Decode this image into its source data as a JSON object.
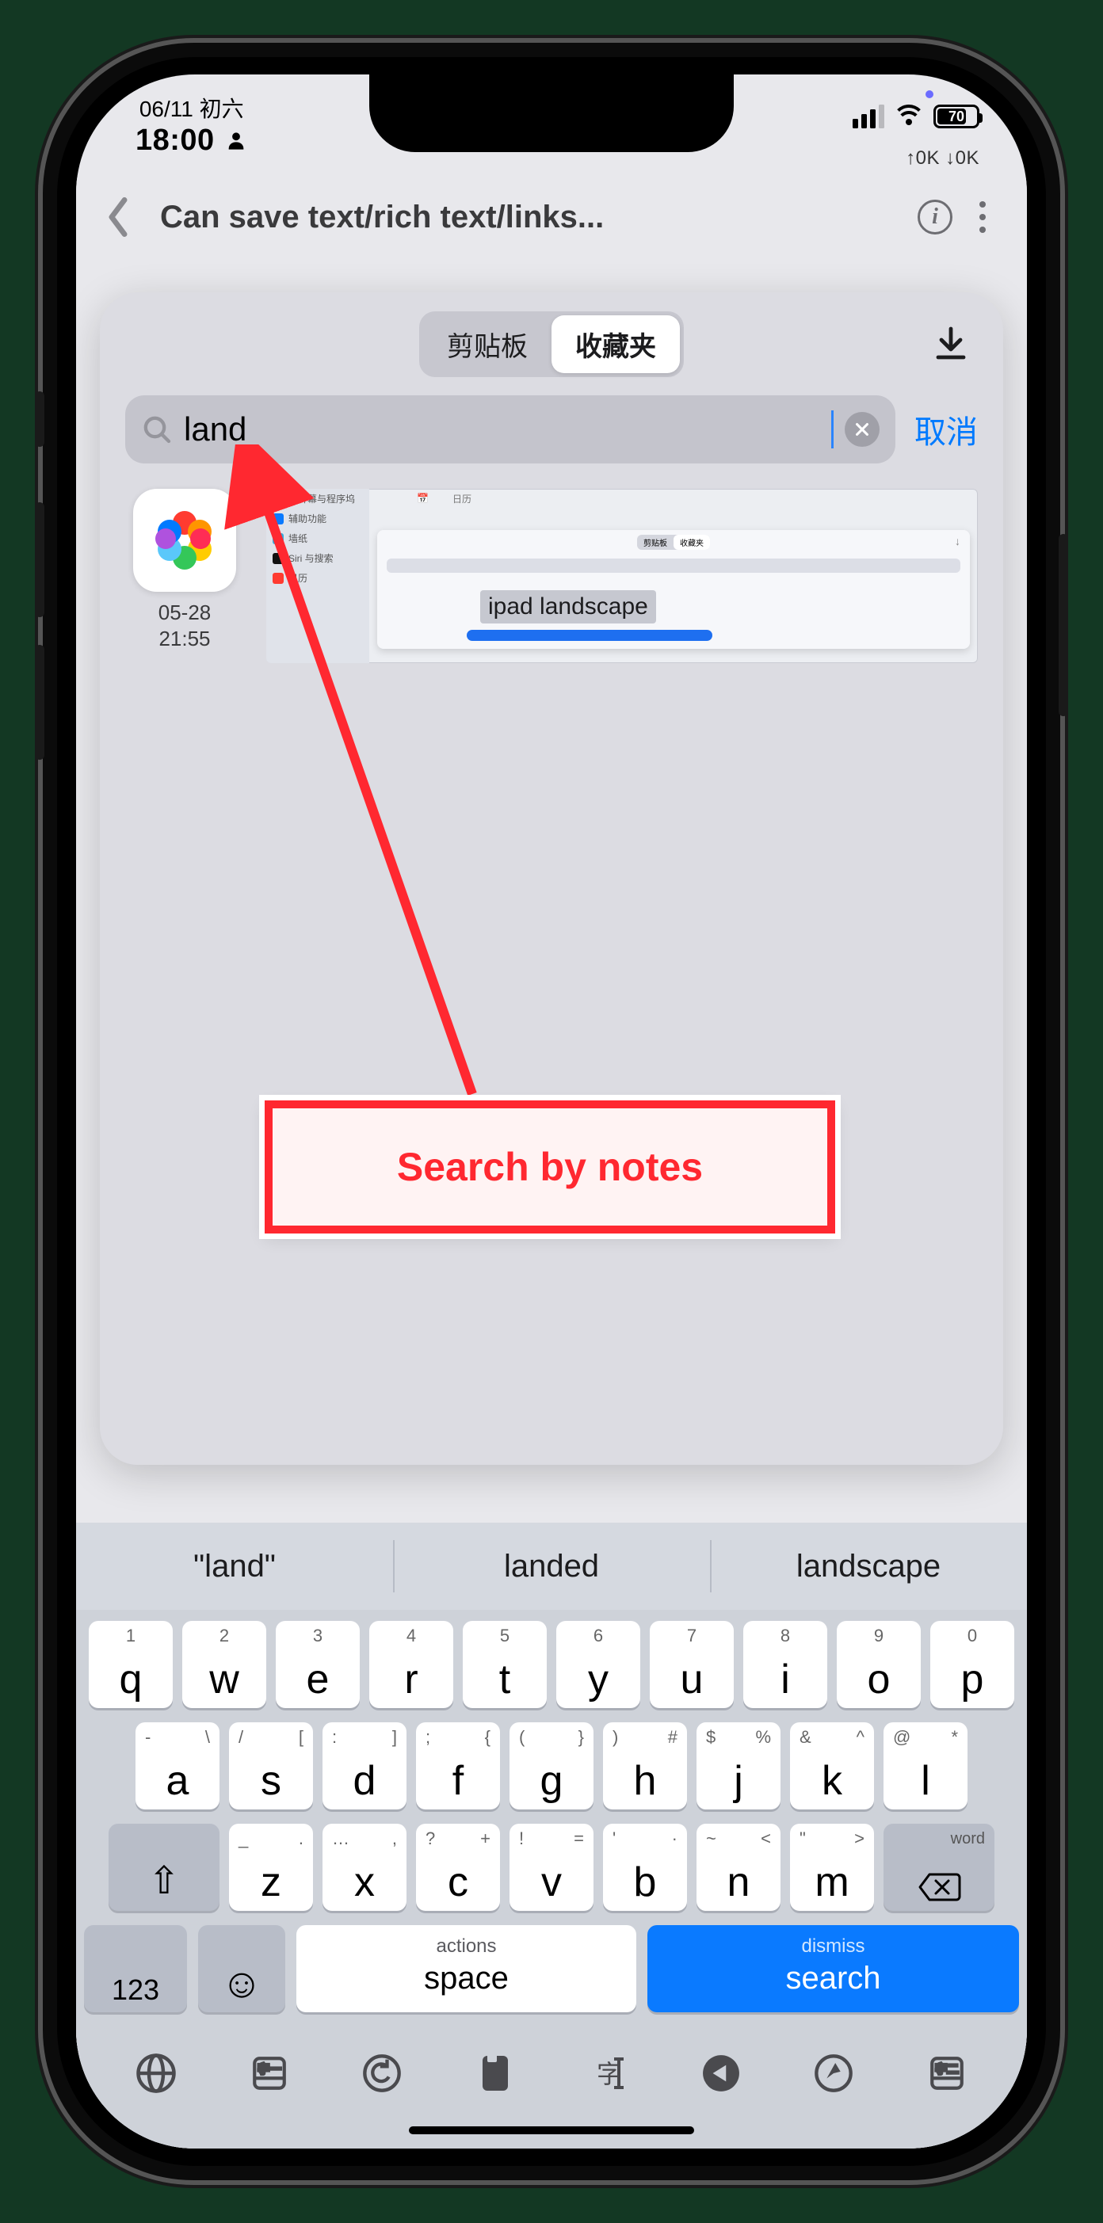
{
  "status": {
    "date_line": "06/11 初六",
    "time": "18:00",
    "battery_pct": "70",
    "net_stats": "↑0K ↓0K"
  },
  "nav": {
    "title": "Can save text/rich text/links..."
  },
  "sheet": {
    "tabs": {
      "clipboard": "剪贴板",
      "favorites": "收藏夹"
    },
    "search_value": "land",
    "cancel": "取消",
    "result": {
      "timestamp_line1": "05-28",
      "timestamp_line2": "21:55",
      "highlight_text": "ipad landscape",
      "preview_sidebar": [
        "主屏幕与程序坞",
        "辅助功能",
        "墙纸",
        "Siri 与搜索",
        "日历"
      ],
      "preview_hdr_cal": "日历"
    },
    "annotation": "Search by notes"
  },
  "keyboard": {
    "suggestions": [
      "\"land\"",
      "landed",
      "landscape"
    ],
    "row1": [
      {
        "m": "q",
        "l": "1"
      },
      {
        "m": "w",
        "l": "2"
      },
      {
        "m": "e",
        "l": "3"
      },
      {
        "m": "r",
        "l": "4"
      },
      {
        "m": "t",
        "l": "5"
      },
      {
        "m": "y",
        "l": "6"
      },
      {
        "m": "u",
        "l": "7"
      },
      {
        "m": "i",
        "l": "8"
      },
      {
        "m": "o",
        "l": "9"
      },
      {
        "m": "p",
        "l": "0"
      }
    ],
    "row2": [
      {
        "m": "a",
        "l": "-",
        "r": "\\"
      },
      {
        "m": "s",
        "l": "/",
        "r": "["
      },
      {
        "m": "d",
        "l": ":",
        "r": "]"
      },
      {
        "m": "f",
        "l": ";",
        "r": "{"
      },
      {
        "m": "g",
        "l": "(",
        "r": "}"
      },
      {
        "m": "h",
        "l": ")",
        "r": "#"
      },
      {
        "m": "j",
        "l": "$",
        "r": "%"
      },
      {
        "m": "k",
        "l": "&",
        "r": "^"
      },
      {
        "m": "l",
        "l": "@",
        "r": "*"
      }
    ],
    "row3": [
      {
        "m": "z",
        "l": "_",
        "r": "."
      },
      {
        "m": "x",
        "l": "…",
        "r": ","
      },
      {
        "m": "c",
        "l": "?",
        "r": "+"
      },
      {
        "m": "v",
        "l": "!",
        "r": "="
      },
      {
        "m": "b",
        "l": "'",
        "r": "·"
      },
      {
        "m": "n",
        "l": "~",
        "r": "<"
      },
      {
        "m": "m",
        "l": "\"",
        "r": ">"
      }
    ],
    "delete_hint": "word",
    "num_key": "123",
    "space_hint": "actions",
    "space_label": "space",
    "search_hint": "dismiss",
    "search_label": "search"
  }
}
